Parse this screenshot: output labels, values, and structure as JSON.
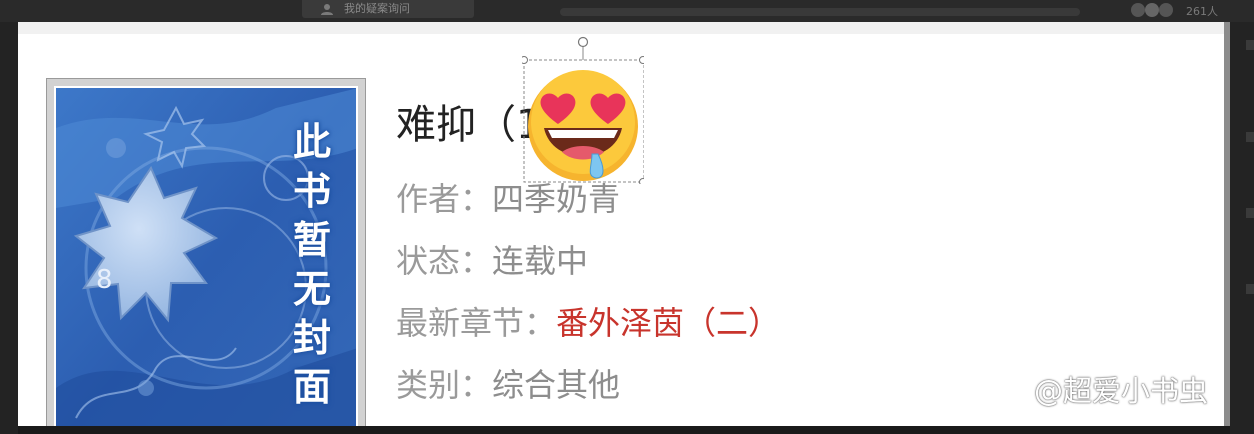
{
  "background": {
    "tab_label": "我的疑案询问",
    "user_count": "261人"
  },
  "book": {
    "title": "难抑（1V1H）",
    "author_label": "作者：",
    "author": "四季奶青",
    "status_label": "状态：",
    "status": "连载中",
    "latest_label": "最新章节：",
    "latest": "番外泽茵（二）",
    "category_label": "类别：",
    "category": "综合其他"
  },
  "cover": {
    "placeholder_text": "此书暂无封面"
  },
  "sticker": {
    "emoji": "heart-eyes-drooling-face"
  },
  "watermark": {
    "text": "@超爱小书虫"
  },
  "colors": {
    "accent_red": "#c8342c",
    "label_gray": "#9a9a9a",
    "cover_blue": "#2f63b8"
  }
}
